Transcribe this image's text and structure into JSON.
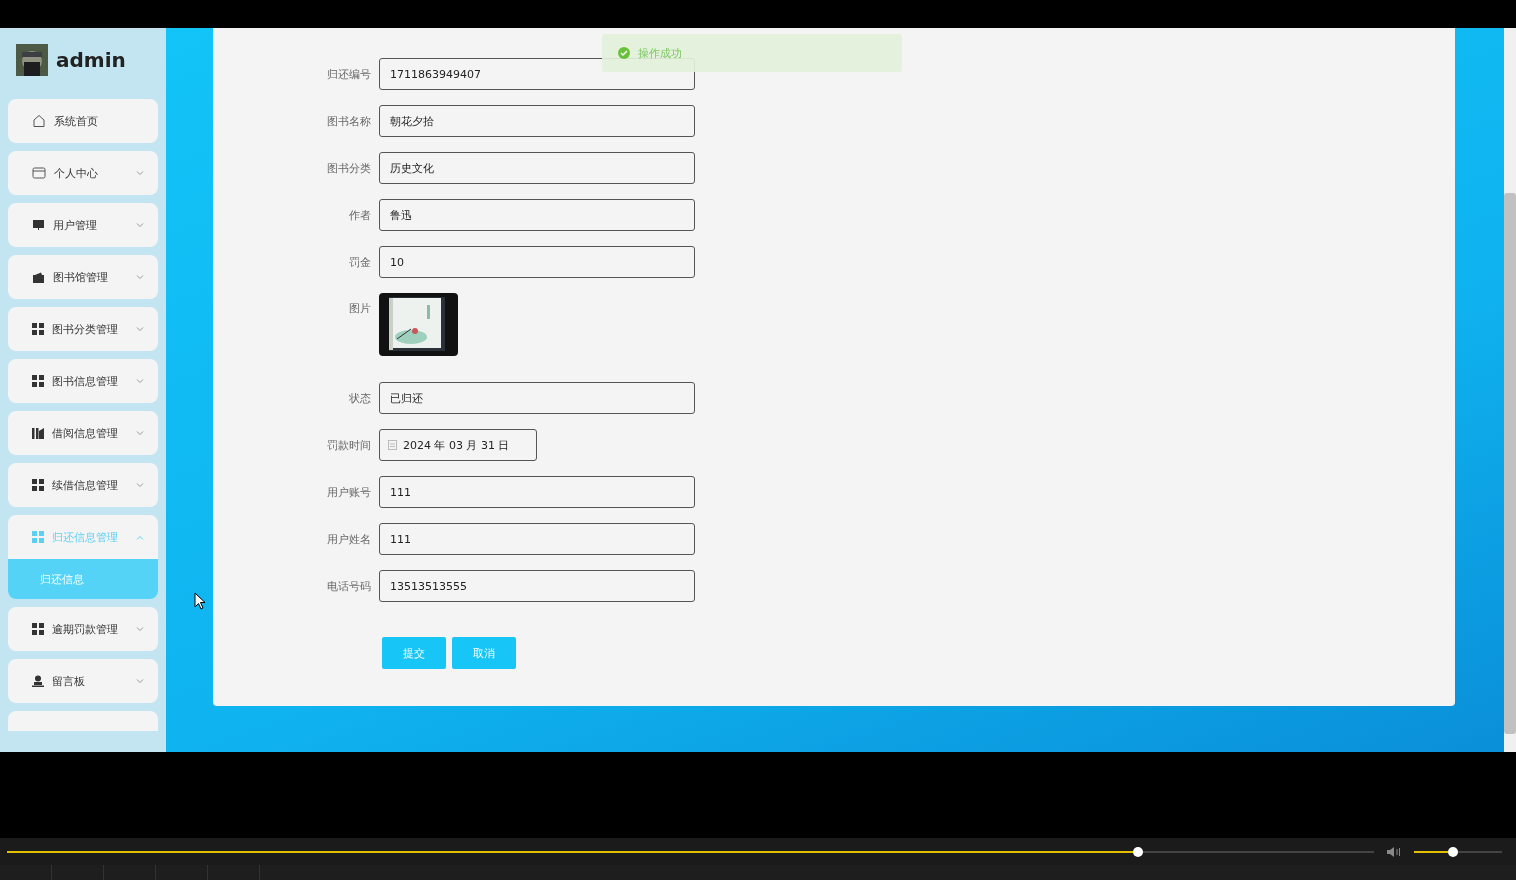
{
  "user": {
    "name": "admin"
  },
  "menu": [
    {
      "label": "系统首页",
      "kind": "home",
      "expandable": false,
      "selected": false
    },
    {
      "label": "个人中心",
      "kind": "card",
      "expandable": true,
      "expanded": false,
      "selected": false
    },
    {
      "label": "用户管理",
      "kind": "monitor",
      "expandable": true,
      "expanded": false,
      "selected": false
    },
    {
      "label": "图书馆管理",
      "kind": "wallet",
      "expandable": true,
      "expanded": false,
      "selected": false
    },
    {
      "label": "图书分类管理",
      "kind": "grid",
      "expandable": true,
      "expanded": false,
      "selected": false
    },
    {
      "label": "图书信息管理",
      "kind": "grid",
      "expandable": true,
      "expanded": false,
      "selected": false
    },
    {
      "label": "借阅信息管理",
      "kind": "books",
      "expandable": true,
      "expanded": false,
      "selected": false
    },
    {
      "label": "续借信息管理",
      "kind": "grid",
      "expandable": true,
      "expanded": false,
      "selected": false
    },
    {
      "label": "归还信息管理",
      "kind": "grid",
      "expandable": true,
      "expanded": true,
      "selected": true,
      "children": [
        {
          "label": "归还信息",
          "selected": true
        }
      ]
    },
    {
      "label": "逾期罚款管理",
      "kind": "grid",
      "expandable": true,
      "expanded": false,
      "selected": false
    },
    {
      "label": "留言板",
      "kind": "user",
      "expandable": true,
      "expanded": false,
      "selected": false
    }
  ],
  "toast": {
    "message": "操作成功"
  },
  "form": {
    "fields": [
      {
        "kind": "text",
        "label": "归还编号",
        "value": "1711863949407"
      },
      {
        "kind": "text",
        "label": "图书名称",
        "value": "朝花夕拾"
      },
      {
        "kind": "text",
        "label": "图书分类",
        "value": "历史文化"
      },
      {
        "kind": "text",
        "label": "作者",
        "value": "鲁迅"
      },
      {
        "kind": "text",
        "label": "罚金",
        "value": "10"
      },
      {
        "label": "图片"
      },
      {
        "kind": "text",
        "label": "状态",
        "value": "已归还"
      },
      {
        "kind": "date",
        "label": "罚款时间",
        "value": "2024 年 03 月 31 日"
      },
      {
        "kind": "text",
        "label": "用户账号",
        "value": "111"
      },
      {
        "kind": "text",
        "label": "用户姓名",
        "value": "111"
      },
      {
        "kind": "text",
        "label": "电话号码",
        "value": "13513513555"
      }
    ],
    "buttons": [
      "提交",
      "取消"
    ]
  },
  "player": {
    "progress": {
      "level": 0.827
    },
    "volume": {
      "level": 0.44
    }
  }
}
